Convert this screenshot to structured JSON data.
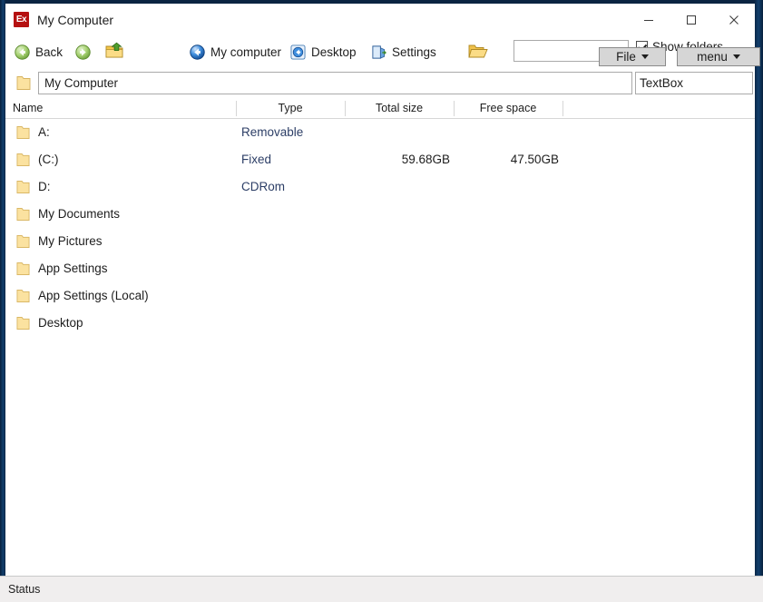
{
  "window": {
    "title": "My Computer",
    "app_icon_text": "Ex",
    "app_icon_color": "#b51111",
    "border_color": "#0d2b4e",
    "controls": {
      "minimize": "minimize-button",
      "maximize": "maximize-button",
      "close": "close-button"
    }
  },
  "toolbar": {
    "back_label": "Back",
    "back_icon": "back-arrow-icon",
    "forward_icon": "forward-arrow-icon",
    "up_folder_icon": "up-folder-icon",
    "items": [
      {
        "label": "My computer",
        "icon": "my-computer-icon"
      },
      {
        "label": "Desktop",
        "icon": "desktop-icon"
      },
      {
        "label": "Settings",
        "icon": "settings-icon"
      }
    ],
    "open_folder_icon": "open-folder-icon",
    "search_value": "",
    "search_placeholder": "",
    "show_folders_label": "Show folders",
    "show_folders_checked": true,
    "file_dropdown_label": "File",
    "menu_dropdown_label": "menu"
  },
  "address": {
    "folder_icon": "folder-icon",
    "value": "My Computer",
    "placeholder": "",
    "side_textbox_value": "TextBox",
    "side_textbox_placeholder": ""
  },
  "list": {
    "columns": [
      {
        "key": "name",
        "label": "Name"
      },
      {
        "key": "type",
        "label": "Type"
      },
      {
        "key": "total",
        "label": "Total size"
      },
      {
        "key": "free",
        "label": "Free space"
      }
    ],
    "rows": [
      {
        "icon": "folder-icon",
        "name": "A:",
        "type": "Removable",
        "total": "",
        "free": ""
      },
      {
        "icon": "folder-icon",
        "name": " (C:)",
        "type": "Fixed",
        "total": "59.68GB",
        "free": "47.50GB"
      },
      {
        "icon": "folder-icon",
        "name": "D:",
        "type": "CDRom",
        "total": "",
        "free": ""
      },
      {
        "icon": "folder-icon",
        "name": "My Documents",
        "type": "",
        "total": "",
        "free": ""
      },
      {
        "icon": "folder-icon",
        "name": "My Pictures",
        "type": "",
        "total": "",
        "free": ""
      },
      {
        "icon": "folder-icon",
        "name": "App Settings",
        "type": "",
        "total": "",
        "free": ""
      },
      {
        "icon": "folder-icon",
        "name": "App Settings (Local)",
        "type": "",
        "total": "",
        "free": ""
      },
      {
        "icon": "folder-icon",
        "name": "Desktop",
        "type": "",
        "total": "",
        "free": ""
      }
    ]
  },
  "status": {
    "text": "Status"
  }
}
